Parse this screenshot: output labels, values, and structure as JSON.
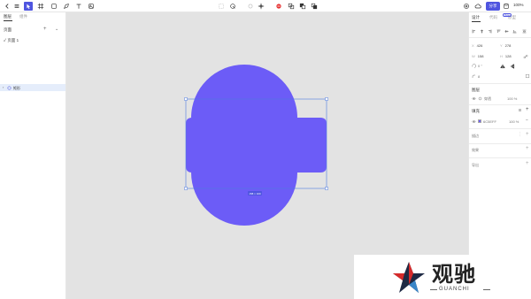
{
  "toolbar": {
    "share_label": "分享",
    "zoom_label": "100%"
  },
  "left_panel": {
    "tabs": [
      "图层",
      "组件"
    ],
    "section_title": "页面",
    "page_name": "页面 1",
    "layer_name": "矩形"
  },
  "canvas": {
    "shape_color": "#6c5cf7",
    "selection_color": "#4f7ae0",
    "size_badge": "158 × 100"
  },
  "right_panel": {
    "tabs": [
      "设计",
      "代码",
      "原型"
    ],
    "beta_badge": "Beta",
    "props": {
      "x": {
        "key": "X",
        "value": "426"
      },
      "y": {
        "key": "Y",
        "value": "278"
      },
      "w": {
        "key": "W",
        "value": "158"
      },
      "h": {
        "key": "H",
        "value": "128"
      },
      "rotation": "0 °",
      "radius": "8"
    },
    "layer_heading": "图层",
    "layer_mode": "穿透",
    "layer_opacity": "100 %",
    "fill_heading": "填充",
    "fill_hex": "6C5EFF",
    "fill_opacity": "100 %",
    "stroke_heading": "描边",
    "effects_heading": "效果",
    "export_heading": "导出"
  },
  "watermark": {
    "title": "观驰",
    "subtitle": "GUANCHI"
  }
}
